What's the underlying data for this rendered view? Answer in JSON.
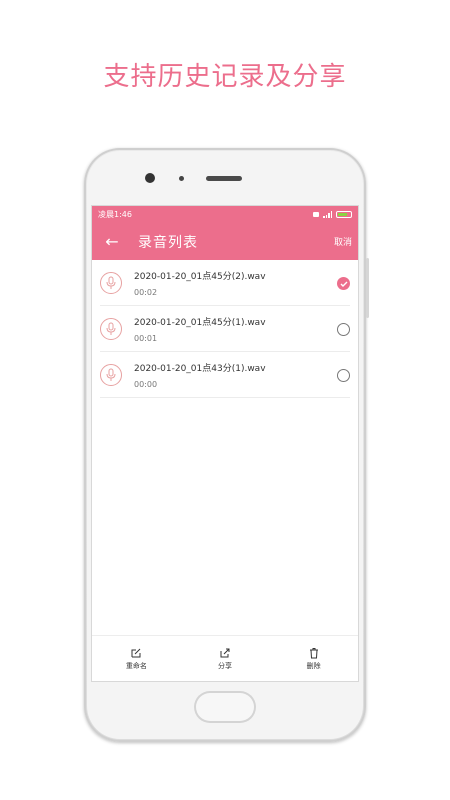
{
  "headline": "支持历史记录及分享",
  "status": {
    "time": "凌晨1:46",
    "battery_text": ""
  },
  "appbar": {
    "back_icon": "←",
    "title": "录音列表",
    "cancel": "取消"
  },
  "recordings": [
    {
      "name": "2020-01-20_01点45分(2).wav",
      "duration": "00:02",
      "selected": true
    },
    {
      "name": "2020-01-20_01点45分(1).wav",
      "duration": "00:01",
      "selected": false
    },
    {
      "name": "2020-01-20_01点43分(1).wav",
      "duration": "00:00",
      "selected": false
    }
  ],
  "toolbar": {
    "rename": "重命名",
    "share": "分享",
    "delete": "删除"
  },
  "colors": {
    "accent": "#ec6e8c",
    "icon_stroke": "#e7a1a1"
  }
}
